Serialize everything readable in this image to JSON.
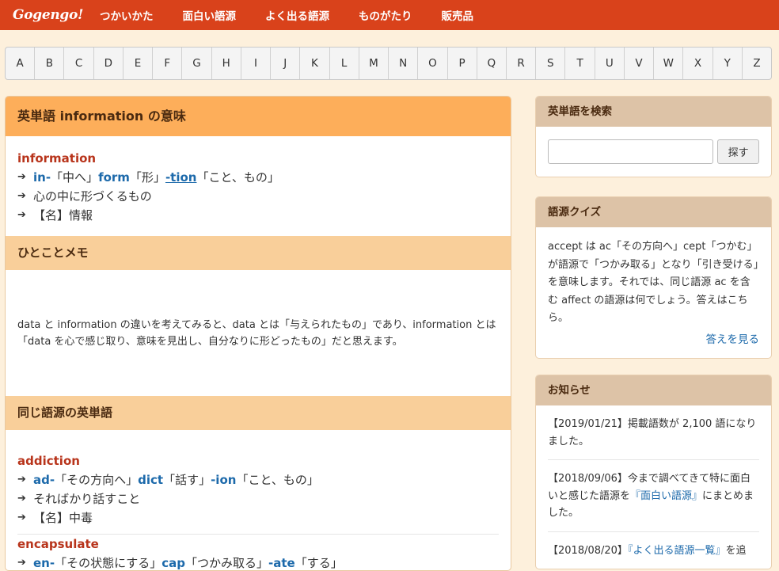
{
  "header": {
    "logo": "Gogengo!",
    "nav": [
      "つかいかた",
      "面白い語源",
      "よく出る語源",
      "ものがたり",
      "販売品"
    ]
  },
  "alphabet": [
    "A",
    "B",
    "C",
    "D",
    "E",
    "F",
    "G",
    "H",
    "I",
    "J",
    "K",
    "L",
    "M",
    "N",
    "O",
    "P",
    "Q",
    "R",
    "S",
    "T",
    "U",
    "V",
    "W",
    "X",
    "Y",
    "Z"
  ],
  "main": {
    "title": "英単語 information の意味",
    "entry": {
      "word": "information",
      "parts": [
        {
          "part": "in-",
          "meaning": "「中へ」"
        },
        {
          "part": "form",
          "meaning": "「形」"
        },
        {
          "part": "-tion",
          "meaning": "「こと、もの」"
        }
      ],
      "gloss": "心の中に形づくるもの",
      "definition": "【名】情報"
    },
    "memo_title": "ひとことメモ",
    "memo_text": "data と information の違いを考えてみると、data とは「与えられたもの」であり、information とは「data を心で感じ取り、意味を見出し、自分なりに形どったもの」だと思えます。",
    "related_title": "同じ語源の英単語",
    "related": [
      {
        "word": "addiction",
        "parts": [
          {
            "part": "ad-",
            "meaning": "「その方向へ」"
          },
          {
            "part": "dict",
            "meaning": "「話す」"
          },
          {
            "part": "-ion",
            "meaning": "「こと、もの」"
          }
        ],
        "gloss": "そればかり話すこと",
        "definition": "【名】中毒"
      },
      {
        "word": "encapsulate",
        "parts": [
          {
            "part": "en-",
            "meaning": "「その状態にする」"
          },
          {
            "part": "cap",
            "meaning": "「つかみ取る」"
          },
          {
            "part": "-ate",
            "meaning": "「する」"
          }
        ]
      }
    ]
  },
  "sidebar": {
    "search": {
      "title": "英単語を検索",
      "value": "",
      "button": "探す"
    },
    "quiz": {
      "title": "語源クイズ",
      "text": "accept は ac「その方向へ」cept「つかむ」が語源で「つかみ取る」となり「引き受ける」を意味します。それでは、同じ語源 ac を含む affect の語源は何でしょう。答えはこちら。",
      "link": "答えを見る"
    },
    "news": {
      "title": "お知らせ",
      "items": [
        {
          "text": "【2019/01/21】掲載語数が 2,100 語になりました。"
        },
        {
          "pre": "【2018/09/06】今まで調べてきて特に面白いと感じた語源を",
          "link": "『面白い語源』",
          "post": "にまとめました。"
        },
        {
          "pre": "【2018/08/20】",
          "link": "『よく出る語源一覧』",
          "post": "を追"
        }
      ]
    }
  }
}
